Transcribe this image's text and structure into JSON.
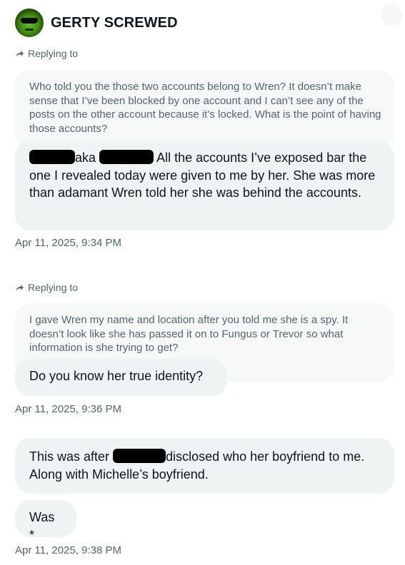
{
  "header": {
    "name": "GERTY SCREWED",
    "avatar_icon": "alien-sunglasses-avatar"
  },
  "groups": [
    {
      "replying_label": "Replying to",
      "quote": "Who told you the those two accounts belong to Wren? It doesn’t make sense that I’ve been blocked by one account and I can’t see any of the posts on the other account because it’s locked. What is the point of having those accounts?",
      "bubble1": {
        "p1": "aka",
        "p2": "All the accounts I’ve exposed bar the one I revealed today were given to me by her. She was more than adamant Wren told her she was behind the accounts."
      },
      "timestamp": "Apr 11, 2025, 9:34 PM"
    },
    {
      "replying_label": "Replying to",
      "quote": "I gave Wren my name and location after you told me she is a spy. It doesn’t look like she has passed it on to Fungus or Trevor so what information is she trying to get?",
      "bubble1": "Do you know her true identity?",
      "timestamp": "Apr 11, 2025, 9:36 PM"
    },
    {
      "bubble1": {
        "p1": "This was after",
        "p2": "disclosed who her boyfriend to me. Along with Michelle’s boyfriend."
      },
      "bubble2": "Was *",
      "timestamp": "Apr 11, 2025, 9:38 PM"
    }
  ]
}
